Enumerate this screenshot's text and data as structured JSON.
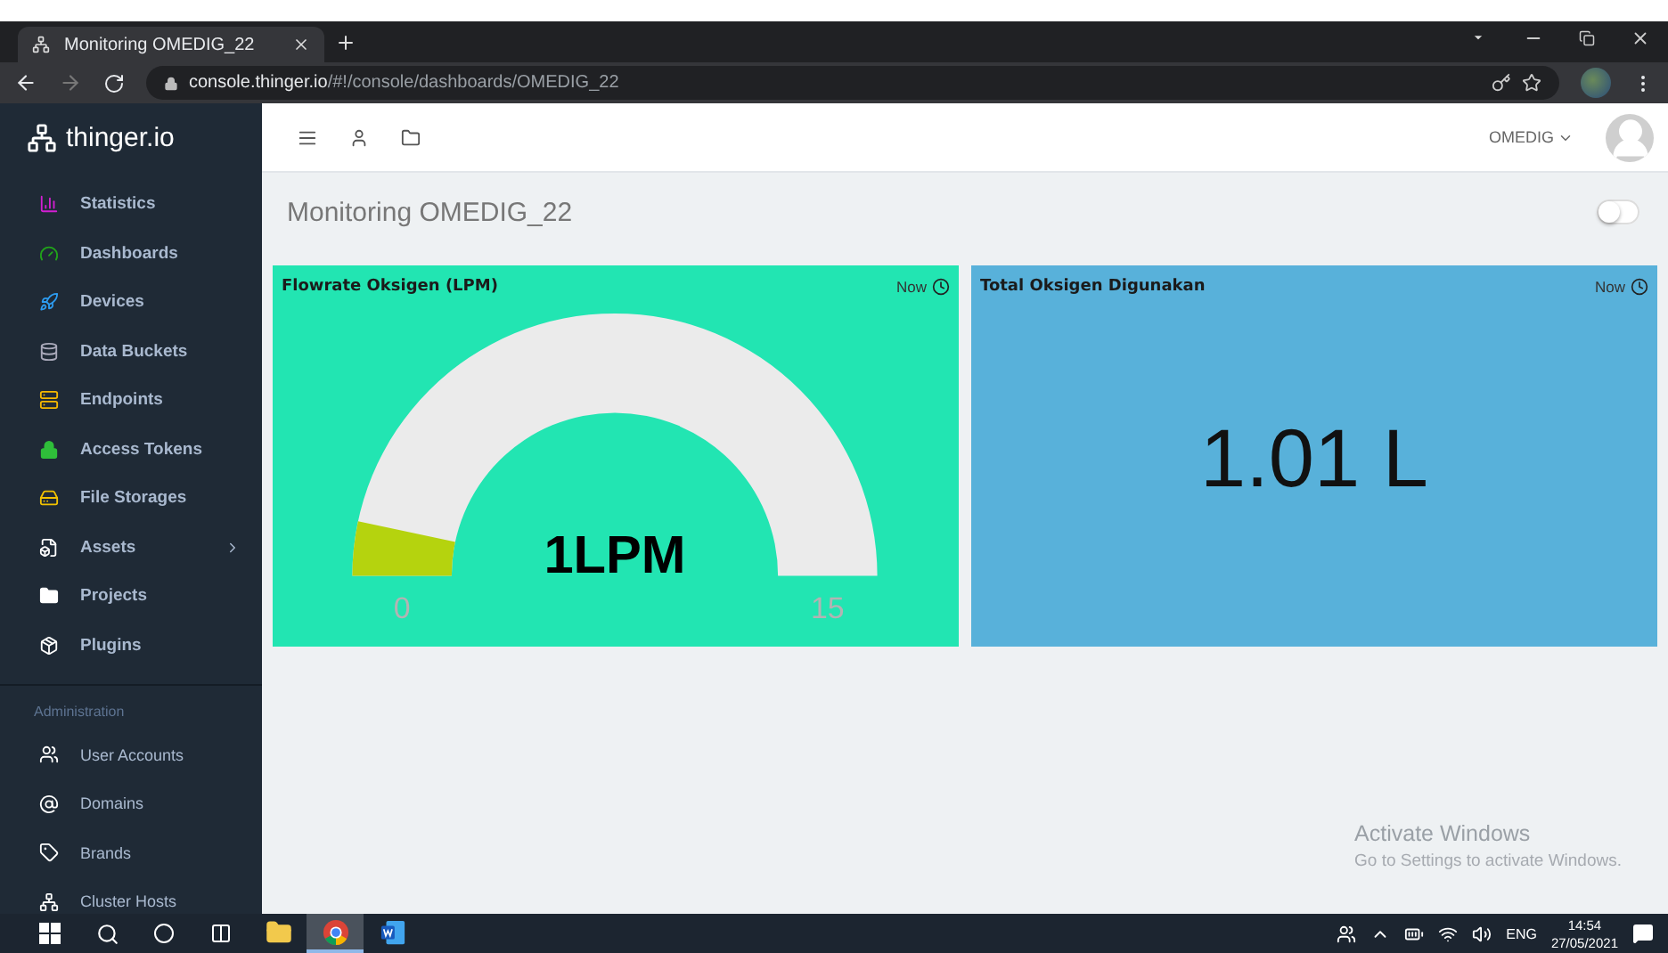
{
  "browser": {
    "tab_title": "Monitoring OMEDIG_22",
    "url_host": "console.thinger.io",
    "url_path": "/#!/console/dashboards/OMEDIG_22"
  },
  "sidebar": {
    "logo": "thinger.io",
    "items": [
      {
        "label": "Statistics",
        "has_children": false
      },
      {
        "label": "Dashboards",
        "has_children": false
      },
      {
        "label": "Devices",
        "has_children": false
      },
      {
        "label": "Data Buckets",
        "has_children": false
      },
      {
        "label": "Endpoints",
        "has_children": false
      },
      {
        "label": "Access Tokens",
        "has_children": false
      },
      {
        "label": "File Storages",
        "has_children": false
      },
      {
        "label": "Assets",
        "has_children": true
      },
      {
        "label": "Projects",
        "has_children": false
      },
      {
        "label": "Plugins",
        "has_children": false
      }
    ],
    "section": "Administration",
    "admin_items": [
      {
        "label": "User Accounts"
      },
      {
        "label": "Domains"
      },
      {
        "label": "Brands"
      },
      {
        "label": "Cluster Hosts"
      }
    ]
  },
  "header": {
    "user": "OMEDIG"
  },
  "dashboard": {
    "title": "Monitoring OMEDIG_22",
    "toggle_on": false
  },
  "widgets": [
    {
      "kind": "gauge",
      "title": "Flowrate Oksigen (LPM)",
      "time": "Now",
      "value": "1LPM",
      "min": "0",
      "max": "15"
    },
    {
      "kind": "text",
      "title": "Total Oksigen Digunakan",
      "time": "Now",
      "value": "1.01 L"
    }
  ],
  "activation": {
    "title": "Activate Windows",
    "hint": "Go to Settings to activate Windows."
  },
  "taskbar": {
    "apps": [
      {
        "selected": false
      },
      {
        "selected": true
      },
      {
        "selected": false
      }
    ],
    "lang": "ENG",
    "time": "14:54",
    "date": "27/05/2021"
  }
}
